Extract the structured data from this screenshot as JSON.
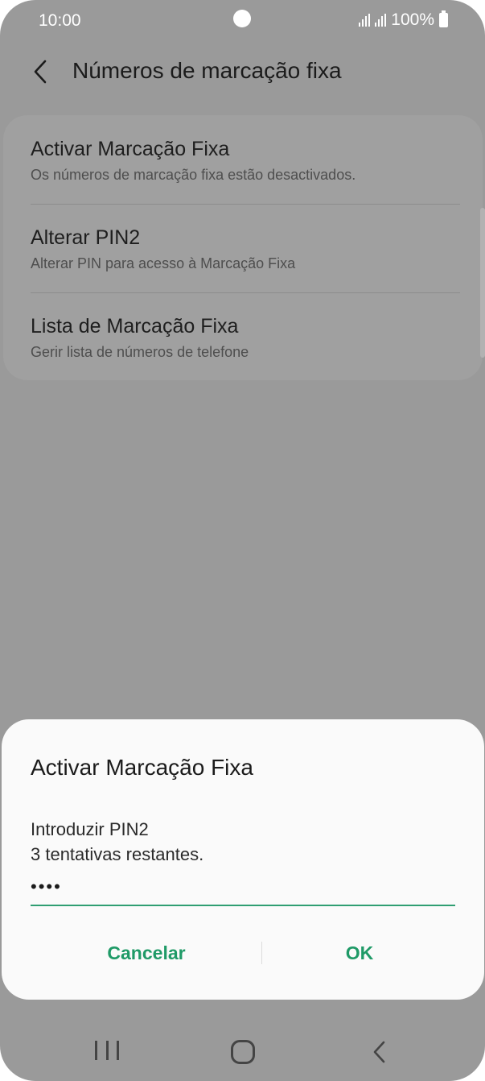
{
  "status_bar": {
    "time": "10:00",
    "battery": "100%"
  },
  "header": {
    "title": "Números de marcação fixa",
    "back_icon": "chevron-left-icon"
  },
  "settings": {
    "items": [
      {
        "title": "Activar Marcação Fixa",
        "subtitle": "Os números de marcação fixa estão desactivados."
      },
      {
        "title": "Alterar PIN2",
        "subtitle": "Alterar PIN para acesso à Marcação Fixa"
      },
      {
        "title": "Lista de Marcação Fixa",
        "subtitle": "Gerir lista de números de telefone"
      }
    ]
  },
  "dialog": {
    "title": "Activar Marcação Fixa",
    "line1": "Introduzir PIN2",
    "line2": "3 tentativas restantes.",
    "pin_value": "••••",
    "cancel_label": "Cancelar",
    "ok_label": "OK"
  },
  "colors": {
    "accent": "#1f9a67",
    "scrim": "#9a9a9a"
  },
  "nav": {
    "recent_icon": "recent-apps-icon",
    "home_icon": "home-icon",
    "back_icon": "back-icon"
  }
}
